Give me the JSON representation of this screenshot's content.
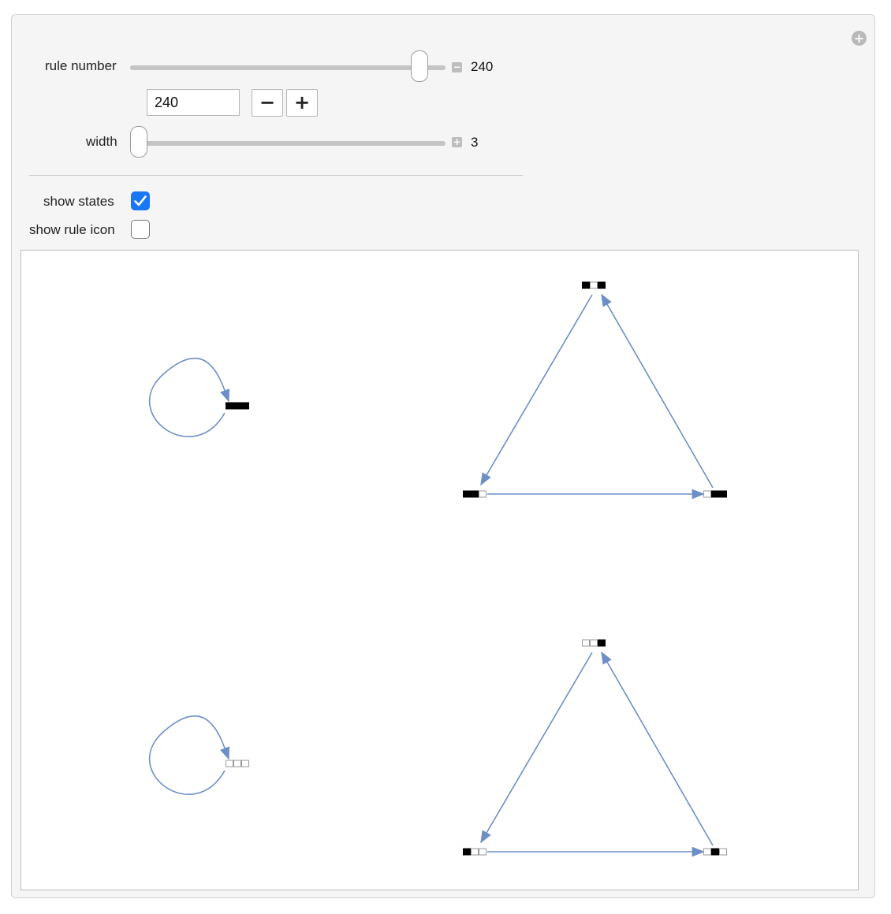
{
  "controls": {
    "rule_number": {
      "label": "rule number",
      "value": "240",
      "slider_fraction": 0.9412,
      "minus_label": "−",
      "plus_label": "+"
    },
    "width": {
      "label": "width",
      "value": "3",
      "slider_fraction": 0
    },
    "show_states": {
      "label": "show states",
      "checked": true
    },
    "show_rule_icon": {
      "label": "show rule icon",
      "checked": false
    }
  },
  "graph": {
    "edge_color": "#6c8fc7",
    "cell_colors": {
      "black": "#000000",
      "white": "#ffffff"
    },
    "components": [
      {
        "type": "self-loop",
        "nodes": [
          {
            "state": "111"
          }
        ]
      },
      {
        "type": "cycle",
        "nodes": [
          {
            "state": "101"
          },
          {
            "state": "110"
          },
          {
            "state": "011"
          }
        ]
      },
      {
        "type": "self-loop",
        "nodes": [
          {
            "state": "000"
          }
        ]
      },
      {
        "type": "cycle",
        "nodes": [
          {
            "state": "001"
          },
          {
            "state": "100"
          },
          {
            "state": "010"
          }
        ]
      }
    ]
  }
}
